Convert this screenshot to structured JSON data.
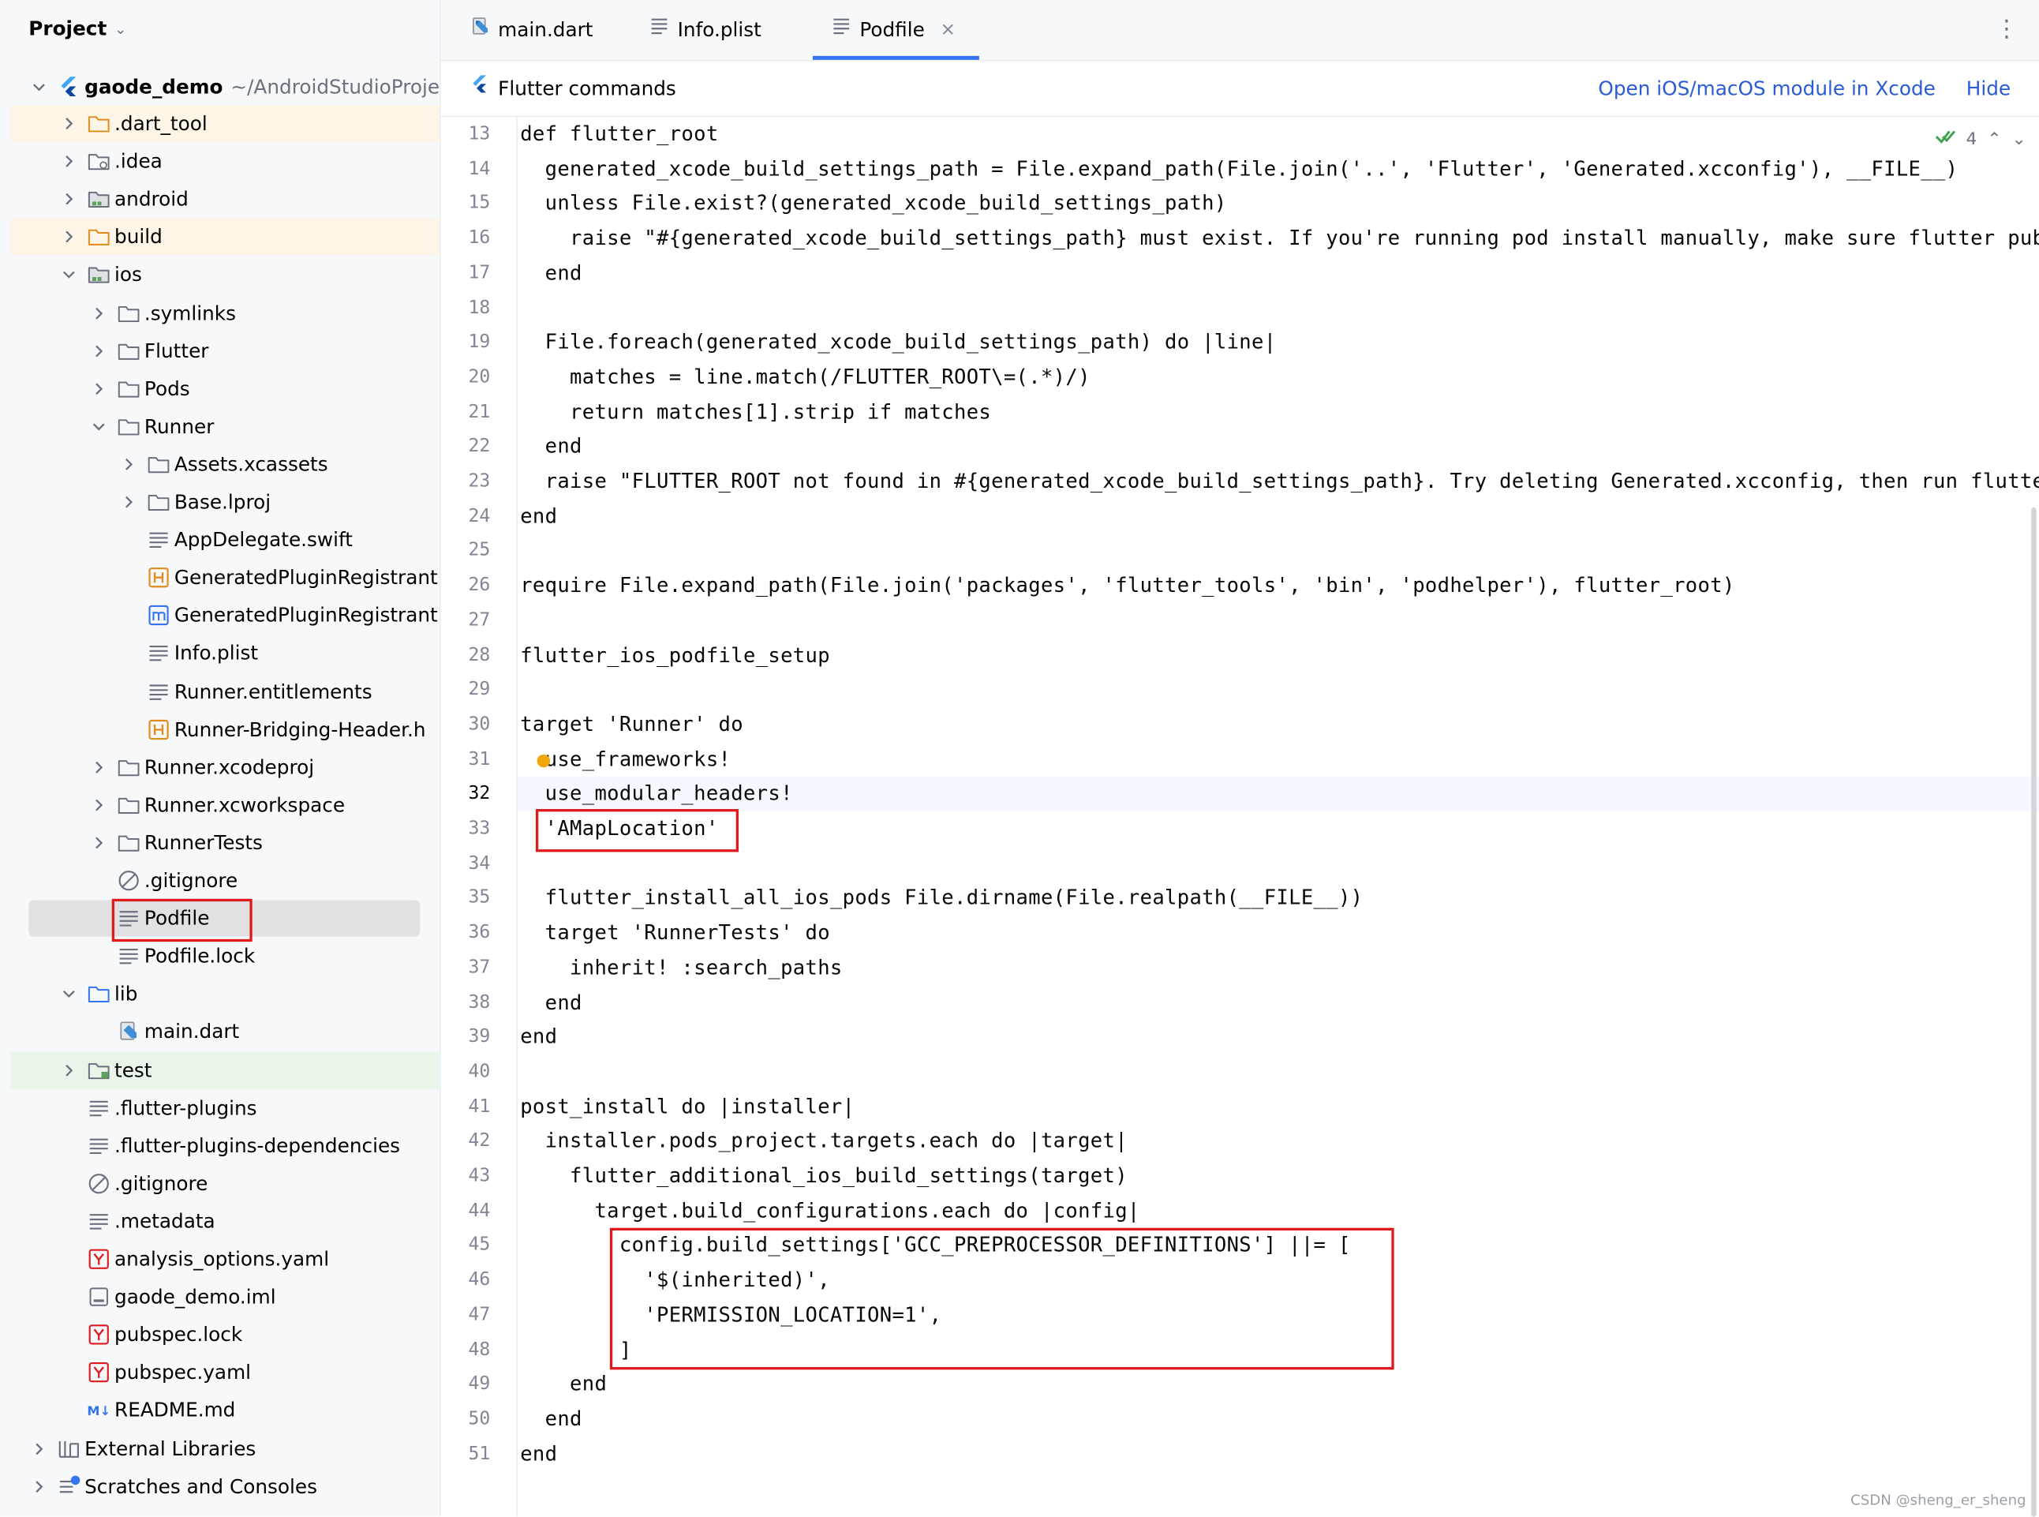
{
  "project_panel": {
    "header": "Project",
    "root": {
      "name": "gaode_demo",
      "path": "~/AndroidStudioProje"
    },
    "items": [
      {
        "label": ".dart_tool",
        "icon": "folder-orange-icon"
      },
      {
        "label": ".idea",
        "icon": "folder-settings-icon"
      },
      {
        "label": "android",
        "icon": "folder-module-icon"
      },
      {
        "label": "build",
        "icon": "folder-orange-icon"
      },
      {
        "label": "ios",
        "icon": "folder-module-icon"
      },
      {
        "label": ".symlinks",
        "icon": "folder-icon"
      },
      {
        "label": "Flutter",
        "icon": "folder-icon"
      },
      {
        "label": "Pods",
        "icon": "folder-icon"
      },
      {
        "label": "Runner",
        "icon": "folder-icon"
      },
      {
        "label": "Assets.xcassets",
        "icon": "folder-icon"
      },
      {
        "label": "Base.lproj",
        "icon": "folder-icon"
      },
      {
        "label": "AppDelegate.swift",
        "icon": "text-file-icon"
      },
      {
        "label": "GeneratedPluginRegistrant.h",
        "icon": "header-file-icon"
      },
      {
        "label": "GeneratedPluginRegistrant.m",
        "icon": "objc-file-icon"
      },
      {
        "label": "Info.plist",
        "icon": "text-file-icon"
      },
      {
        "label": "Runner.entitlements",
        "icon": "text-file-icon"
      },
      {
        "label": "Runner-Bridging-Header.h",
        "icon": "header-file-icon"
      },
      {
        "label": "Runner.xcodeproj",
        "icon": "folder-icon"
      },
      {
        "label": "Runner.xcworkspace",
        "icon": "folder-icon"
      },
      {
        "label": "RunnerTests",
        "icon": "folder-icon"
      },
      {
        "label": ".gitignore",
        "icon": "ignore-file-icon"
      },
      {
        "label": "Podfile",
        "icon": "text-file-icon"
      },
      {
        "label": "Podfile.lock",
        "icon": "text-file-icon"
      },
      {
        "label": "lib",
        "icon": "folder-blue-icon"
      },
      {
        "label": "main.dart",
        "icon": "dart-file-icon"
      },
      {
        "label": "test",
        "icon": "folder-test-icon"
      },
      {
        "label": ".flutter-plugins",
        "icon": "text-file-icon"
      },
      {
        "label": ".flutter-plugins-dependencies",
        "icon": "text-file-icon"
      },
      {
        "label": ".gitignore",
        "icon": "ignore-file-icon"
      },
      {
        "label": ".metadata",
        "icon": "text-file-icon"
      },
      {
        "label": "analysis_options.yaml",
        "icon": "yaml-file-icon"
      },
      {
        "label": "gaode_demo.iml",
        "icon": "iml-file-icon"
      },
      {
        "label": "pubspec.lock",
        "icon": "yaml-file-icon"
      },
      {
        "label": "pubspec.yaml",
        "icon": "yaml-file-icon"
      },
      {
        "label": "README.md",
        "icon": "markdown-file-icon",
        "icon_text": "M↓"
      },
      {
        "label": "External Libraries",
        "icon": "library-icon"
      },
      {
        "label": "Scratches and Consoles",
        "icon": "scratches-icon"
      }
    ]
  },
  "tabs": [
    {
      "label": "main.dart",
      "icon": "dart-file-icon"
    },
    {
      "label": "Info.plist",
      "icon": "text-file-icon"
    },
    {
      "label": "Podfile",
      "icon": "text-file-icon",
      "close": "×"
    }
  ],
  "tab_more": "⋮",
  "flutter_bar": {
    "title": "Flutter commands",
    "open_xcode": "Open iOS/macOS module in Xcode",
    "hide": "Hide"
  },
  "inspection": {
    "count": "4"
  },
  "editor": {
    "current_line": 32,
    "lines": [
      {
        "num": "13",
        "text": "def flutter_root"
      },
      {
        "num": "14",
        "text": "  generated_xcode_build_settings_path = File.expand_path(File.join('..', 'Flutter', 'Generated.xcconfig'), __FILE__)"
      },
      {
        "num": "15",
        "text": "  unless File.exist?(generated_xcode_build_settings_path)"
      },
      {
        "num": "16",
        "text": "    raise \"#{generated_xcode_build_settings_path} must exist. If you're running pod install manually, make sure flutter pub get"
      },
      {
        "num": "17",
        "text": "  end"
      },
      {
        "num": "18",
        "text": ""
      },
      {
        "num": "19",
        "text": "  File.foreach(generated_xcode_build_settings_path) do |line|"
      },
      {
        "num": "20",
        "text": "    matches = line.match(/FLUTTER_ROOT\\=(.*)/)"
      },
      {
        "num": "21",
        "text": "    return matches[1].strip if matches"
      },
      {
        "num": "22",
        "text": "  end"
      },
      {
        "num": "23",
        "text": "  raise \"FLUTTER_ROOT not found in #{generated_xcode_build_settings_path}. Try deleting Generated.xcconfig, then run flutter pub get\""
      },
      {
        "num": "24",
        "text": "end"
      },
      {
        "num": "25",
        "text": ""
      },
      {
        "num": "26",
        "text": "require File.expand_path(File.join('packages', 'flutter_tools', 'bin', 'podhelper'), flutter_root)"
      },
      {
        "num": "27",
        "text": ""
      },
      {
        "num": "28",
        "text": "flutter_ios_podfile_setup"
      },
      {
        "num": "29",
        "text": ""
      },
      {
        "num": "30",
        "text": "target 'Runner' do"
      },
      {
        "num": "31",
        "text": "  use_frameworks!"
      },
      {
        "num": "32",
        "text": "  use_modular_headers!"
      },
      {
        "num": "33",
        "text": "  'AMapLocation'"
      },
      {
        "num": "34",
        "text": ""
      },
      {
        "num": "35",
        "text": "  flutter_install_all_ios_pods File.dirname(File.realpath(__FILE__))"
      },
      {
        "num": "36",
        "text": "  target 'RunnerTests' do"
      },
      {
        "num": "37",
        "text": "    inherit! :search_paths"
      },
      {
        "num": "38",
        "text": "  end"
      },
      {
        "num": "39",
        "text": "end"
      },
      {
        "num": "40",
        "text": ""
      },
      {
        "num": "41",
        "text": "post_install do |installer|"
      },
      {
        "num": "42",
        "text": "  installer.pods_project.targets.each do |target|"
      },
      {
        "num": "43",
        "text": "    flutter_additional_ios_build_settings(target)"
      },
      {
        "num": "44",
        "text": "      target.build_configurations.each do |config|"
      },
      {
        "num": "45",
        "text": "        config.build_settings['GCC_PREPROCESSOR_DEFINITIONS'] ||= ["
      },
      {
        "num": "46",
        "text": "          '$(inherited)',"
      },
      {
        "num": "47",
        "text": "          'PERMISSION_LOCATION=1',"
      },
      {
        "num": "48",
        "text": "        ]"
      },
      {
        "num": "49",
        "text": "    end"
      },
      {
        "num": "50",
        "text": "  end"
      },
      {
        "num": "51",
        "text": "end"
      }
    ]
  },
  "watermark": "CSDN @sheng_er_sheng",
  "colors": {
    "highlight_box": "#e0191f",
    "link": "#2a5bd7",
    "selected_row": "#e1e1e4",
    "excluded_folder_row": "#fdf5e6",
    "test_folder_row": "#eaf5e9"
  }
}
